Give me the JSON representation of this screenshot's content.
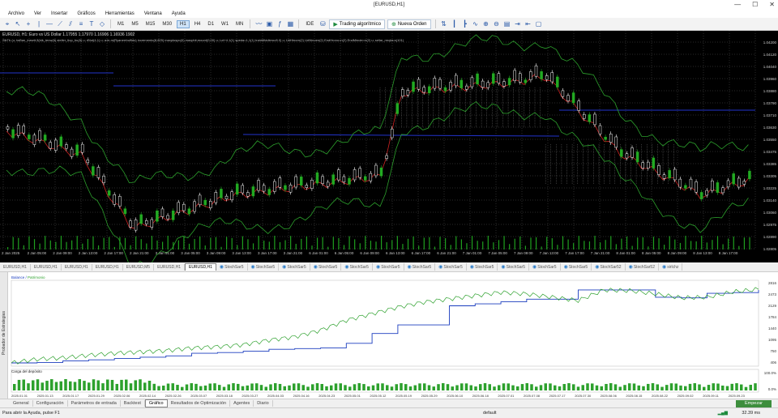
{
  "window": {
    "title": "[EURUSD,H1]"
  },
  "menu": [
    "Archivo",
    "Ver",
    "Insertar",
    "Gráficos",
    "Herramientas",
    "Ventana",
    "Ayuda"
  ],
  "toolbar": {
    "timeframes": [
      "M1",
      "M5",
      "M15",
      "M30",
      "H1",
      "H4",
      "D1",
      "W1",
      "MN"
    ],
    "active_timeframe": "H1",
    "ide_label": "IDE",
    "algo_label": "Trading algorítmico",
    "new_order_label": "Nueva Orden"
  },
  "chart": {
    "symbol_line": "EURUSD, H1:  Euro vs US Dollar  1.17955 1.17970 1.16906 1.16936  1902",
    "params_line": "SlkTb (u; twBan_inewtt;3(ldk_tenw(6) steller_tiop_bu(6) u; rBlut(4,1) u; a:in-m(Ryanerrbulfido) incremento(8,825) maxpluspo(0) maxphit;mount(0,00) u; Lot+4.1(1) speda=1,1(1) trainMiddleroo5.0) u; LktHinorn(2) LktNinoen(2) EndHrono=n(2) EndMinute=n(2) u; sellar_rmqbs:s(101)",
    "price_ticks": [
      "1.04200",
      "1.04120",
      "1.04040",
      "1.03960",
      "1.03880",
      "1.03790",
      "1.03710",
      "1.03630",
      "1.03550",
      "1.03475",
      "1.03385",
      "1.03305",
      "1.03225",
      "1.03140",
      "1.03060",
      "1.02975",
      "1.02890",
      "1.02805"
    ],
    "time_ticks": [
      "2 Jan 2025",
      "2 Jan 05:00",
      "2 Jan 09:00",
      "2 Jan 13:00",
      "2 Jan 17:00",
      "2 Jan 21:00",
      "3 Jan 01:00",
      "3 Jan 05:00",
      "3 Jan 09:00",
      "3 Jan 13:00",
      "3 Jan 17:00",
      "3 Jan 21:00",
      "6 Jan 01:00",
      "6 Jan 05:00",
      "6 Jan 09:00",
      "6 Jan 13:00",
      "6 Jan 17:00",
      "6 Jan 21:00",
      "7 Jan 01:00",
      "7 Jan 05:00",
      "7 Jan 09:00",
      "7 Jan 13:00",
      "7 Jan 17:00",
      "7 Jan 21:00",
      "8 Jan 01:00",
      "8 Jan 05:00",
      "8 Jan 09:00",
      "8 Jan 13:00",
      "8 Jan 17:00"
    ],
    "colors": {
      "bg": "#000000",
      "grid": "#2a2a2a",
      "bull": "#ffffff",
      "bear": "#22aa22",
      "volume": "#1fa01f",
      "ma": "#cc2222",
      "band": "#2ca02c",
      "level": "#2233cc"
    }
  },
  "symbol_tabs": [
    {
      "label": "EURUSD,H1",
      "kind": "chart"
    },
    {
      "label": "EURUSD,H1",
      "kind": "chart"
    },
    {
      "label": "EURUSD,H1",
      "kind": "chart"
    },
    {
      "label": "EURUSD,H1",
      "kind": "chart"
    },
    {
      "label": "EURUSD,M5",
      "kind": "chart"
    },
    {
      "label": "EURUSD,H1",
      "kind": "chart"
    },
    {
      "label": "EURUSD,H1",
      "kind": "chart",
      "active": true
    },
    {
      "label": "StochSar5",
      "kind": "tester"
    },
    {
      "label": "StochSar5",
      "kind": "tester"
    },
    {
      "label": "StochSar5",
      "kind": "tester"
    },
    {
      "label": "StochSar5",
      "kind": "tester"
    },
    {
      "label": "StochSar5",
      "kind": "tester"
    },
    {
      "label": "StochSar5",
      "kind": "tester"
    },
    {
      "label": "StochSar5",
      "kind": "tester"
    },
    {
      "label": "StochSar5",
      "kind": "tester"
    },
    {
      "label": "StochSar5",
      "kind": "tester"
    },
    {
      "label": "StochSar5",
      "kind": "tester"
    },
    {
      "label": "StochSar5",
      "kind": "tester"
    },
    {
      "label": "StochSar5",
      "kind": "tester"
    },
    {
      "label": "StochSar52",
      "kind": "tester"
    },
    {
      "label": "StochSar52",
      "kind": "tester"
    },
    {
      "label": "sirlchz",
      "kind": "tester"
    }
  ],
  "tester": {
    "side_label": "Probador de Estrategias",
    "legend_balance": "Balance",
    "legend_equity": "Patrimonio",
    "y_ticks": [
      "2816",
      "2473",
      "2129",
      "1784",
      "1440",
      "1095",
      "750",
      "406"
    ],
    "load_label": "Carga del depósito",
    "load_ticks": [
      "100.0%",
      "0.0%"
    ],
    "x_ticks": [
      "2025.01.01",
      "2025.01.13",
      "2025.01.17",
      "2025.01.29",
      "2025.02.06",
      "2025.02.14",
      "2025.02.26",
      "2025.03.07",
      "2025.03.18",
      "2025.03.27",
      "2025.04.03",
      "2025.04.16",
      "2025.04.23",
      "2025.05.01",
      "2025.05.12",
      "2025.05.19",
      "2025.05.29",
      "2025.06.10",
      "2025.06.18",
      "2025.07.01",
      "2025.07.08",
      "2025.07.17",
      "2025.07.30",
      "2025.08.06",
      "2025.08.15",
      "2025.08.22",
      "2025.09.02",
      "2025.09.11",
      "2025.09.23"
    ],
    "colors": {
      "balance": "#1b3dbf",
      "equity": "#2da12d",
      "load": "#2da12d"
    },
    "chart_data": {
      "type": "line",
      "ylim": [
        406,
        2816
      ],
      "series": [
        {
          "name": "Balance",
          "values": [
            406,
            420,
            470,
            500,
            540,
            580,
            620,
            700,
            720,
            760,
            820,
            840,
            860,
            1000,
            1300,
            1560,
            1560,
            2140,
            2200,
            2260,
            2340,
            2340,
            2620,
            2620,
            2620,
            2400,
            2380,
            2520,
            2540,
            2620
          ]
        },
        {
          "name": "Patrimonio",
          "values": [
            406,
            520,
            560,
            640,
            700,
            740,
            780,
            860,
            900,
            960,
            1100,
            1200,
            1400,
            1700,
            1900,
            2100,
            2250,
            2350,
            2450,
            2550,
            2500,
            2400,
            2300,
            2620,
            2600,
            2500,
            2380,
            2400,
            2560,
            2640
          ]
        }
      ]
    }
  },
  "bottom_tabs": [
    "General",
    "Configuración",
    "Parámetros de entrada",
    "Backtest",
    "Gráfico",
    "Resultados de Optimización",
    "Agentes",
    "Diario"
  ],
  "active_bottom_tab": "Gráfico",
  "start_label": "Empezar",
  "status": {
    "help": "Para abrir la Ayuda, pulse F1",
    "profile": "default",
    "ping": "32.39 ms"
  }
}
